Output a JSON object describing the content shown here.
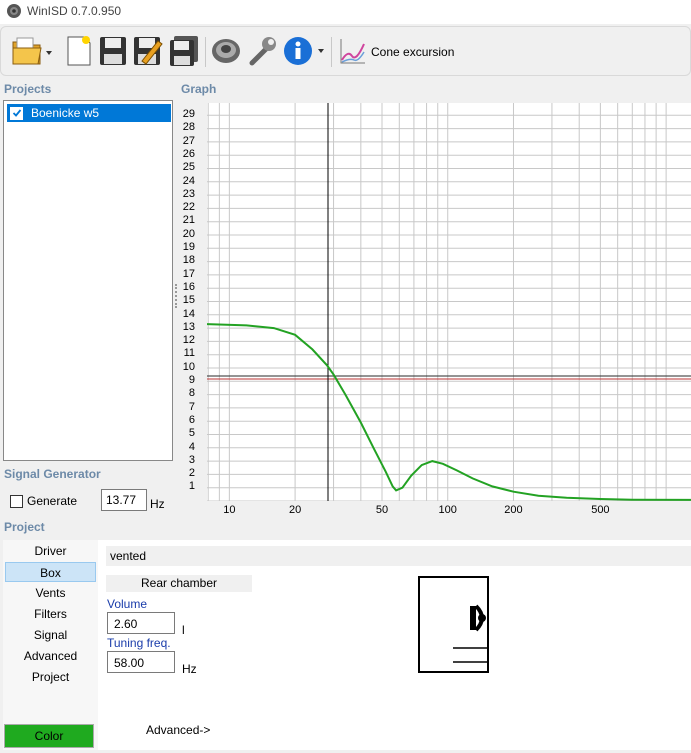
{
  "window": {
    "title": "WinISD 0.7.0.950"
  },
  "toolbar": {
    "cone_label": "Cone excursion"
  },
  "sections": {
    "projects": "Projects",
    "graph": "Graph",
    "signal_generator": "Signal Generator",
    "project": "Project"
  },
  "projects": [
    {
      "name": "Boenicke w5",
      "checked": true
    }
  ],
  "signal": {
    "generate_label": "Generate",
    "frequency": "13.77",
    "unit": "Hz"
  },
  "graph": {
    "y_ticks": [
      "29",
      "28",
      "27",
      "26",
      "25",
      "24",
      "23",
      "22",
      "21",
      "20",
      "19",
      "18",
      "17",
      "16",
      "15",
      "14",
      "13",
      "12",
      "11",
      "10",
      "9",
      "8",
      "7",
      "6",
      "5",
      "4",
      "3",
      "2",
      "1"
    ],
    "x_ticks": [
      "10",
      "20",
      "50",
      "100",
      "200",
      "500"
    ],
    "curve_color": "#23a223"
  },
  "nav": {
    "items": [
      "Driver",
      "Box",
      "Vents",
      "Filters",
      "Signal",
      "Advanced",
      "Project"
    ],
    "active": "Box",
    "color_button": "Color"
  },
  "box": {
    "type": "vented",
    "rear_chamber": "Rear chamber",
    "volume_label": "Volume",
    "volume_value": "2.60",
    "volume_unit": "l",
    "tuning_label": "Tuning freq.",
    "tuning_value": "58.00",
    "tuning_unit": "Hz",
    "advanced": "Advanced->"
  }
}
